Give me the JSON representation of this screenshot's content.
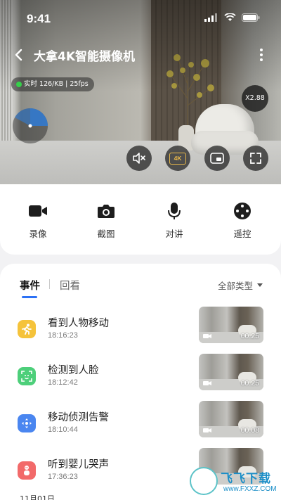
{
  "status_bar": {
    "time": "9:41"
  },
  "header": {
    "title": "大拿4K智能摄像机"
  },
  "video": {
    "live_label": "实时 126/KB | 25fps",
    "zoom_level": "X2.88",
    "controls": [
      {
        "name": "mute",
        "icon": "speaker-mute-icon"
      },
      {
        "name": "quality",
        "icon": "4k-icon",
        "label": "4K"
      },
      {
        "name": "pip",
        "icon": "picture-in-picture-icon"
      },
      {
        "name": "fullscreen",
        "icon": "fullscreen-icon"
      }
    ],
    "colors": {
      "live_dot": "#35d04a",
      "radar": "#2f7bd6",
      "quality_icon": "#e8b84a"
    }
  },
  "actions": [
    {
      "label": "录像",
      "icon": "video-camera-icon"
    },
    {
      "label": "截图",
      "icon": "camera-icon"
    },
    {
      "label": "对讲",
      "icon": "microphone-icon"
    },
    {
      "label": "遥控",
      "icon": "joystick-icon"
    }
  ],
  "events_panel": {
    "tabs": [
      "事件",
      "回看"
    ],
    "filter_label": "全部类型",
    "items": [
      {
        "title": "看到人物移动",
        "time": "18:16:23",
        "duration": "00:25",
        "icon": "running-person-icon",
        "color": "#f5c33b"
      },
      {
        "title": "检测到人脸",
        "time": "18:12:42",
        "duration": "00:25",
        "icon": "face-scan-icon",
        "color": "#4dcf7a"
      },
      {
        "title": "移动侦测告警",
        "time": "18:10:44",
        "duration": "00:08",
        "icon": "motion-arrows-icon",
        "color": "#4a86f0"
      },
      {
        "title": "听到婴儿哭声",
        "time": "17:36:23",
        "duration": "",
        "icon": "baby-icon",
        "color": "#f26a6a"
      }
    ],
    "next_date": "11月01日"
  },
  "watermark": {
    "text": "飞飞下载",
    "url": "www.FXXZ.COM"
  },
  "accent": "#2c71f5"
}
